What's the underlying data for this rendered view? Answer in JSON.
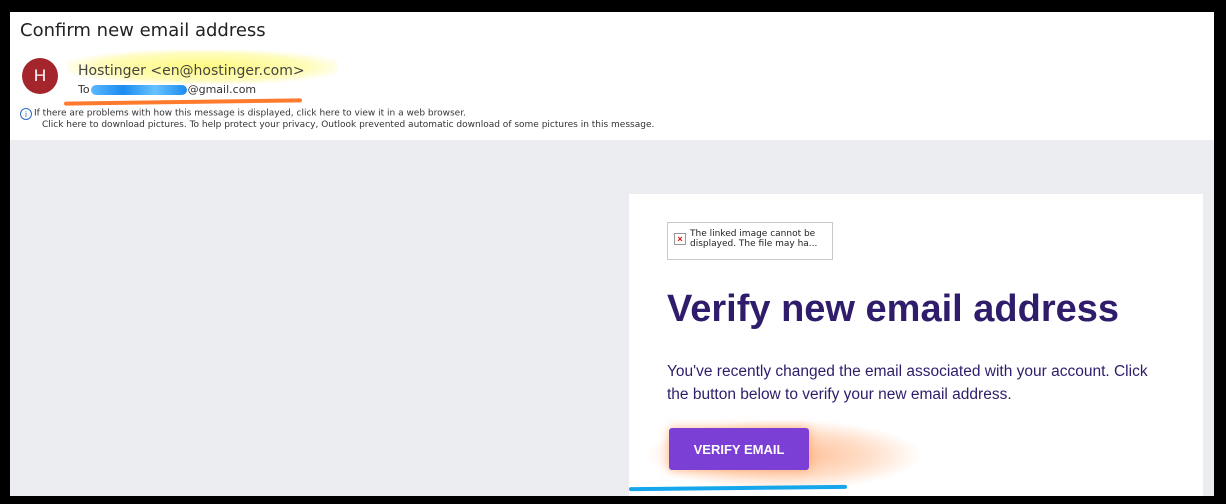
{
  "email": {
    "subject": "Confirm new email address",
    "avatar_letter": "H",
    "sender": "Hostinger <en@hostinger.com>",
    "to_prefix": "To",
    "to_suffix": "@gmail.com",
    "info_line_1": "If there are problems with how this message is displayed, click here to view it in a web browser.",
    "info_line_2": "Click here to download pictures. To help protect your privacy, Outlook prevented automatic download of some pictures in this message."
  },
  "content": {
    "broken_image_text": "The linked image cannot be displayed.  The file may ha...",
    "heading": "Verify new email address",
    "description": "You've recently changed the email associated with your account. Click the button below to verify your new email address.",
    "button_label": "VERIFY EMAIL"
  },
  "colors": {
    "heading": "#2f1c6a",
    "button": "#7b3fd6",
    "avatar": "#a4262c"
  }
}
